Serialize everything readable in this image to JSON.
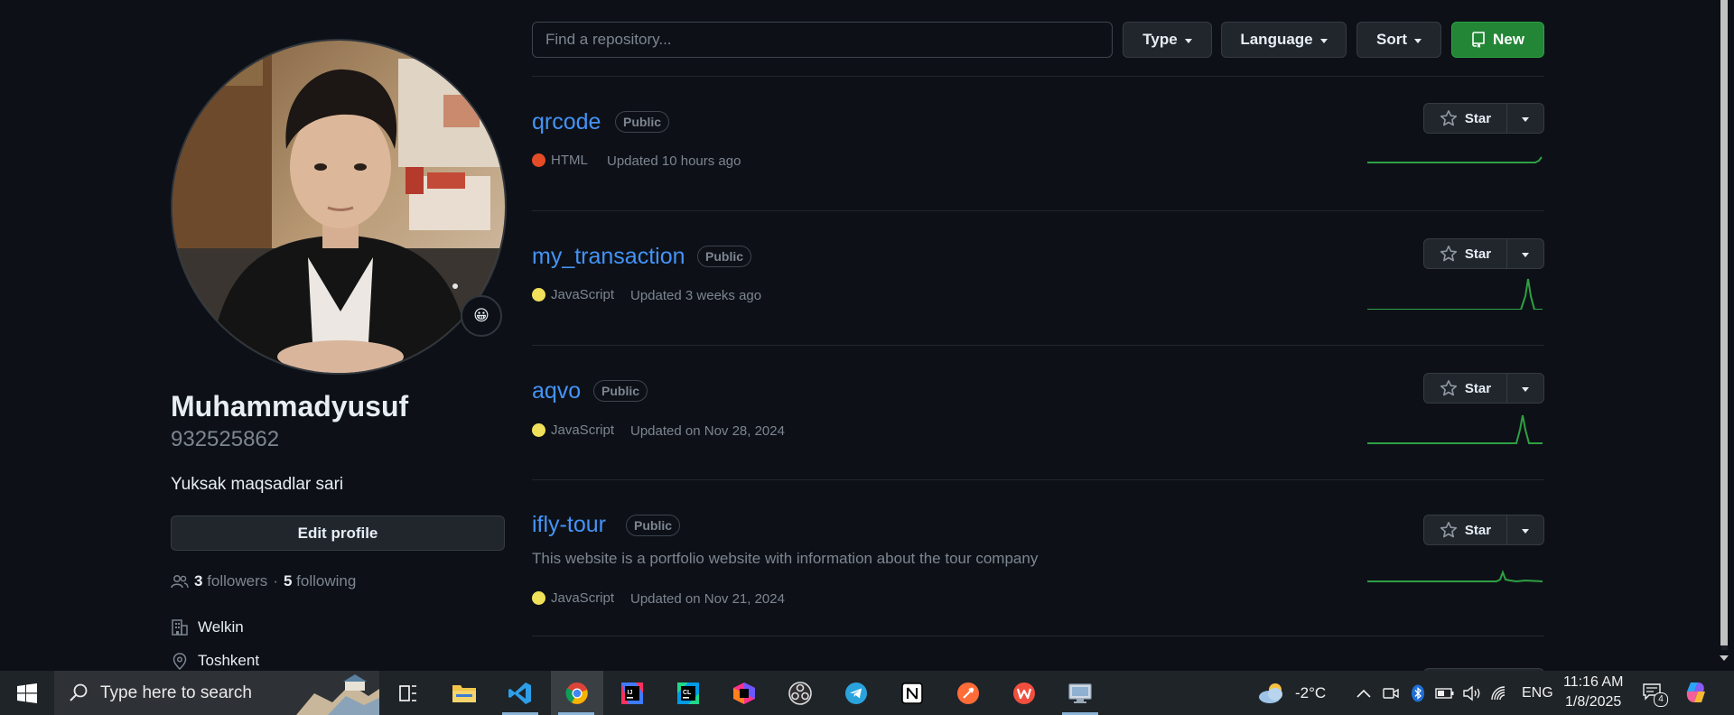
{
  "profile": {
    "name": "Muhammadyusuf",
    "login": "932525862",
    "bio": "Yuksak maqsadlar sari",
    "edit_label": "Edit profile",
    "followers_count": "3",
    "followers_label": "followers",
    "separator": "·",
    "following_count": "5",
    "following_label": "following",
    "company": "Welkin",
    "location": "Toshkent",
    "status_emoji": "😀"
  },
  "filters": {
    "search_placeholder": "Find a repository...",
    "type_label": "Type",
    "language_label": "Language",
    "sort_label": "Sort",
    "new_label": "New"
  },
  "repos": [
    {
      "name": "qrcode",
      "visibility": "Public",
      "language": "HTML",
      "language_color": "#e34c26",
      "updated": "Updated 10 hours ago",
      "description": "",
      "star_label": "Star"
    },
    {
      "name": "my_transaction",
      "visibility": "Public",
      "language": "JavaScript",
      "language_color": "#f1e05a",
      "updated": "Updated 3 weeks ago",
      "description": "",
      "star_label": "Star"
    },
    {
      "name": "aqvo",
      "visibility": "Public",
      "language": "JavaScript",
      "language_color": "#f1e05a",
      "updated": "Updated on Nov 28, 2024",
      "description": "",
      "star_label": "Star"
    },
    {
      "name": "ifly-tour",
      "visibility": "Public",
      "language": "JavaScript",
      "language_color": "#f1e05a",
      "updated": "Updated on Nov 21, 2024",
      "description": "This website is a portfolio website with information about the tour company",
      "star_label": "Star"
    }
  ],
  "colors": {
    "link": "#4493f8",
    "bg": "#0d1117",
    "button_bg": "#21262d",
    "new_green": "#238636",
    "spark_green": "#2ea043"
  },
  "taskbar": {
    "search_placeholder": "Type here to search",
    "weather": "-2°C",
    "language": "ENG",
    "time": "11:16 AM",
    "date": "1/8/2025",
    "notification_count": "4",
    "apps": [
      "task-view",
      "file-explorer",
      "vscode",
      "chrome",
      "intellij",
      "clion",
      "jetbrains-toolbox",
      "obs",
      "telegram",
      "notion",
      "postman",
      "wps-office",
      "remote-desktop"
    ]
  }
}
